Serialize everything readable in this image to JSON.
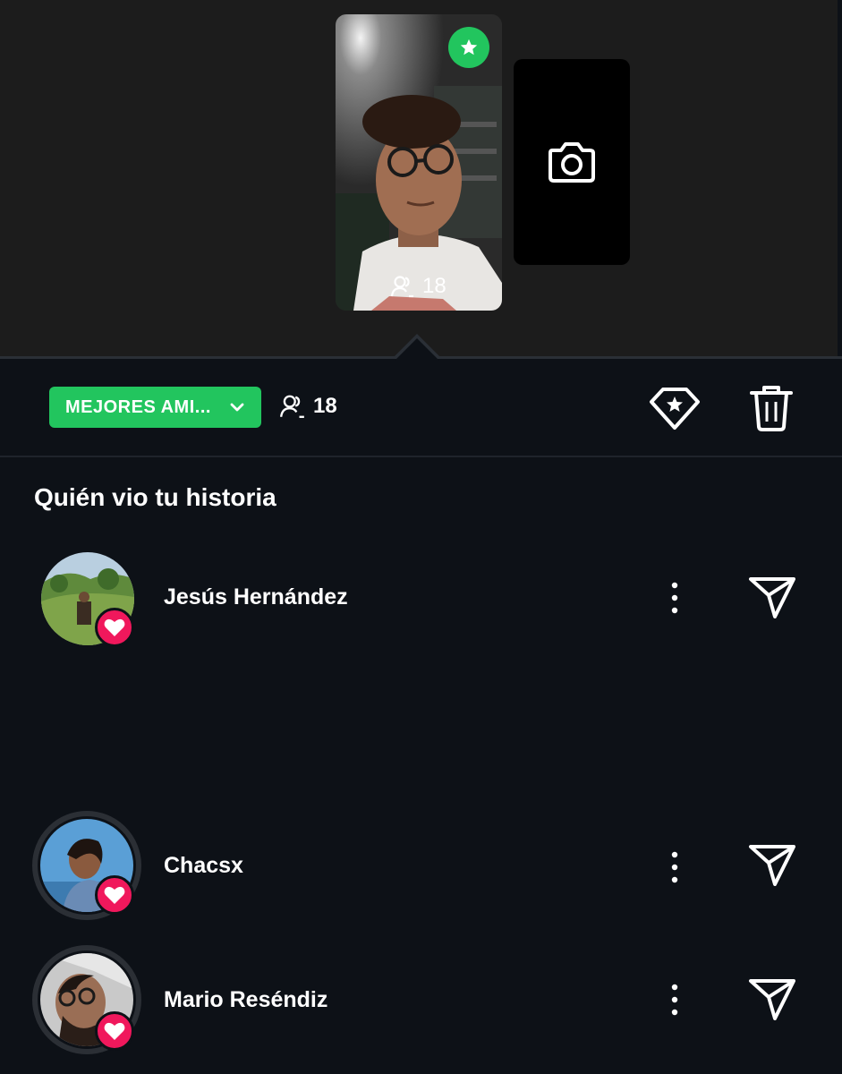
{
  "story": {
    "viewer_count": "18",
    "badge_icon": "star-icon",
    "camera_icon": "camera-icon"
  },
  "toolbar": {
    "audience_label": "MEJORES AMI...",
    "viewer_count": "18",
    "highlight_icon": "diamond-star-icon",
    "delete_icon": "trash-icon"
  },
  "viewers_section": {
    "title": "Quién vio tu historia",
    "viewers": [
      {
        "name": "Jesús Hernández",
        "liked": true
      },
      {
        "name": "Chacsx",
        "liked": true
      },
      {
        "name": "Mario Reséndiz",
        "liked": true
      }
    ]
  },
  "colors": {
    "accent_green": "#22c55e",
    "heart_pink": "#f0185c",
    "background": "#0d1117",
    "top_background": "#1c1c1c"
  }
}
